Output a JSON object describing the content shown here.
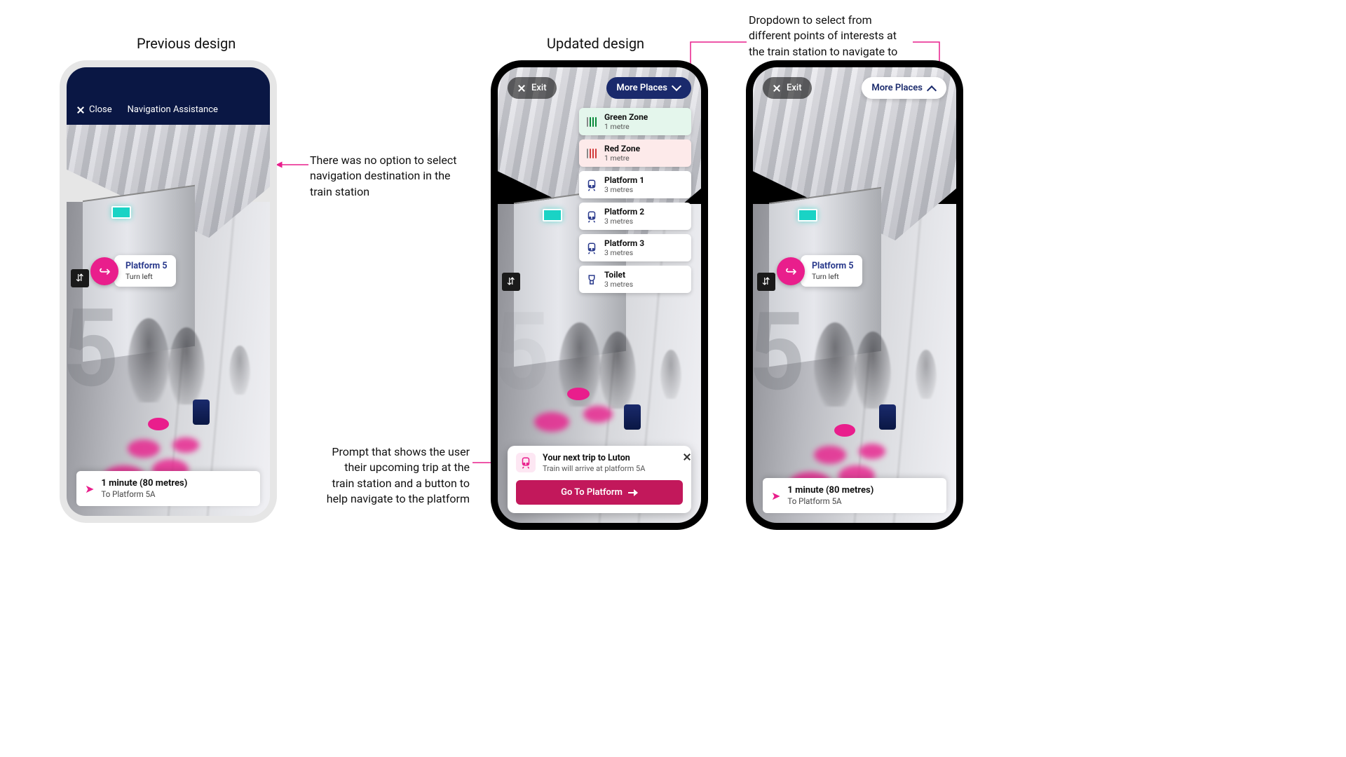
{
  "headings": {
    "previous": "Previous design",
    "updated": "Updated design"
  },
  "annotations": {
    "no_option": "There was no option to select navigation destination in the train station",
    "prompt": "Prompt that shows the user their upcoming trip at the train station and a button to help navigate to the platform",
    "dropdown": "Dropdown to select from different points of interests at the train station to navigate to"
  },
  "old": {
    "close": "Close",
    "nav_title": "Navigation Assistance",
    "dir_title": "Platform 5",
    "dir_sub": "Turn left",
    "status_title": "1 minute (80 metres)",
    "status_sub": "To Platform 5A"
  },
  "updated_a": {
    "exit": "Exit",
    "more_places": "More Places",
    "places": [
      {
        "name": "Green Zone",
        "dist": "1 metre",
        "variant": "green",
        "icon": "gate-green"
      },
      {
        "name": "Red Zone",
        "dist": "1 metre",
        "variant": "red",
        "icon": "gate-red"
      },
      {
        "name": "Platform 1",
        "dist": "3 metres",
        "variant": "white",
        "icon": "train"
      },
      {
        "name": "Platform 2",
        "dist": "3 metres",
        "variant": "white",
        "icon": "train"
      },
      {
        "name": "Platform 3",
        "dist": "3 metres",
        "variant": "white",
        "icon": "train"
      },
      {
        "name": "Toilet",
        "dist": "3 metres",
        "variant": "white",
        "icon": "toilet"
      }
    ],
    "trip_title": "Your next trip to Luton",
    "trip_sub": "Train will arrive at platform 5A",
    "trip_btn": "Go To Platform"
  },
  "updated_b": {
    "exit": "Exit",
    "more_places": "More Places",
    "dir_title": "Platform 5",
    "dir_sub": "Turn left",
    "status_title": "1 minute (80 metres)",
    "status_sub": "To Platform 5A"
  }
}
